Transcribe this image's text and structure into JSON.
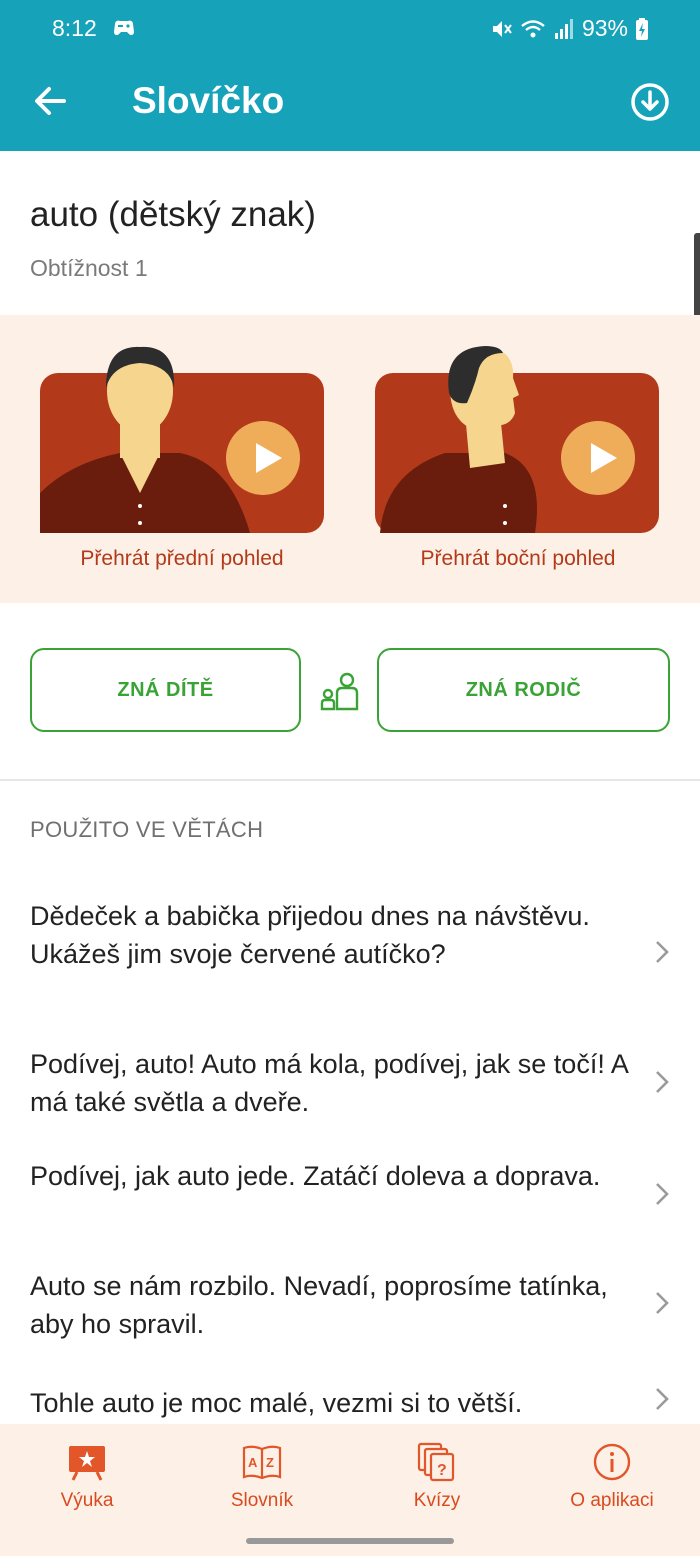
{
  "status": {
    "time": "8:12",
    "battery": "93%"
  },
  "appbar": {
    "title": "Slovíčko"
  },
  "word": {
    "title": "auto (dětský znak)",
    "difficulty": "Obtížnost 1"
  },
  "videos": {
    "front_label": "Přehrát přední pohled",
    "side_label": "Přehrát boční pohled"
  },
  "know": {
    "child": "ZNÁ DÍTĚ",
    "parent": "ZNÁ RODIČ"
  },
  "sentences_header": "POUŽITO VE VĚTÁCH",
  "sentences": [
    "Dědeček a babička přijedou dnes na návštěvu. Ukážeš jim svoje červené autíčko?",
    "Podívej, auto! Auto má kola, podívej, jak se točí! A má také světla a dveře.",
    "Podívej, jak auto jede. Zatáčí doleva a doprava.",
    "Auto se nám rozbilo. Nevadí, poprosíme tatínka, aby ho spravil.",
    "Tohle auto je moc malé, vezmi si to větší."
  ],
  "nav": [
    {
      "label": "Výuka",
      "icon": "lesson-board-icon"
    },
    {
      "label": "Slovník",
      "icon": "dictionary-icon"
    },
    {
      "label": "Kvízy",
      "icon": "quiz-cards-icon"
    },
    {
      "label": "O aplikaci",
      "icon": "info-icon"
    }
  ],
  "colors": {
    "primary": "#16a2b8",
    "accent_green": "#3aa335",
    "video_red": "#b23a1a",
    "nav_orange": "#d94b1f",
    "panel_bg": "#fdf0e6"
  }
}
